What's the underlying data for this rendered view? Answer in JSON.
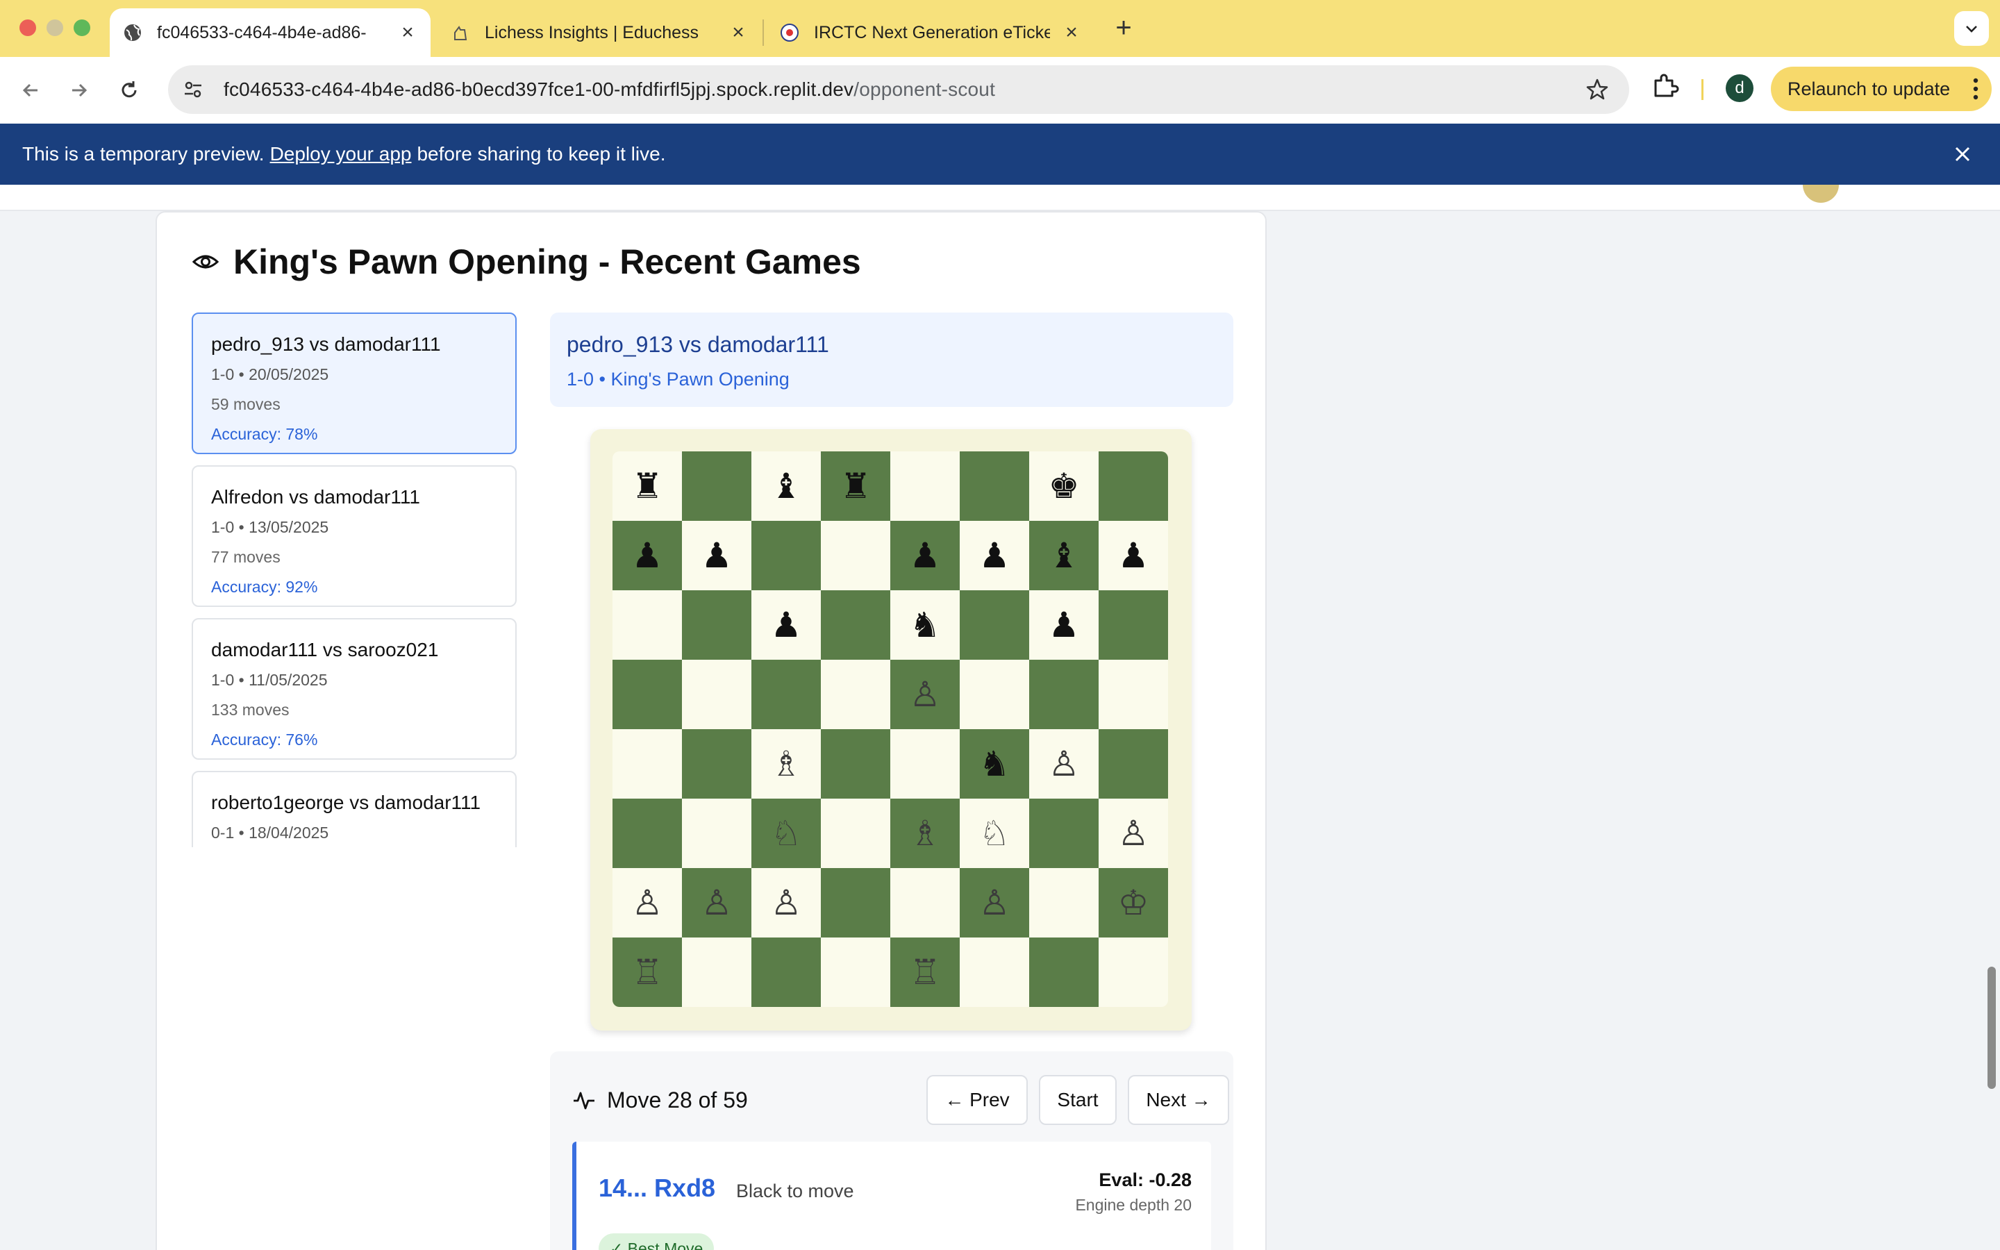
{
  "browser": {
    "tabs": [
      {
        "title": "fc046533-c464-4b4e-ad86-",
        "active": true,
        "favicon": "globe-icon"
      },
      {
        "title": "Lichess Insights | Educhess",
        "active": false,
        "favicon": "lichess-icon"
      },
      {
        "title": "IRCTC Next Generation eTicke",
        "active": false,
        "favicon": "irctc-icon"
      }
    ],
    "url_host": "fc046533-c464-4b4e-ad86-b0ecd397fce1-00-mfdfirfl5jpj.spock.replit.dev",
    "url_path": "/opponent-scout",
    "profile_initial": "d",
    "relaunch_label": "Relaunch to update"
  },
  "banner": {
    "text_before": "This is a temporary preview.",
    "link": "Deploy your app",
    "text_after": "before sharing to keep it live."
  },
  "section": {
    "title": "King's Pawn Opening - Recent Games"
  },
  "games": [
    {
      "title": "pedro_913 vs damodar111",
      "meta": "1-0 • 20/05/2025",
      "moves": "59 moves",
      "accuracy": "Accuracy: 78%",
      "selected": true
    },
    {
      "title": "Alfredon vs damodar111",
      "meta": "1-0 • 13/05/2025",
      "moves": "77 moves",
      "accuracy": "Accuracy: 92%",
      "selected": false
    },
    {
      "title": "damodar111 vs sarooz021",
      "meta": "1-0 • 11/05/2025",
      "moves": "133 moves",
      "accuracy": "Accuracy: 76%",
      "selected": false
    },
    {
      "title": "roberto1george vs damodar111",
      "meta": "0-1 • 18/04/2025",
      "moves": "",
      "accuracy": "",
      "selected": false
    }
  ],
  "selected_game": {
    "title": "pedro_913 vs damodar111",
    "subtitle": "1-0 • King's Pawn Opening"
  },
  "board": {
    "rows": [
      [
        "r",
        "",
        "b",
        "r",
        "",
        "",
        "k",
        ""
      ],
      [
        "p",
        "p",
        "",
        "",
        "p",
        "p",
        "b",
        "p"
      ],
      [
        "",
        "",
        "p",
        "",
        "n",
        "",
        "p",
        ""
      ],
      [
        "",
        "",
        "",
        "",
        "P",
        "",
        "",
        ""
      ],
      [
        "",
        "",
        "B",
        "",
        "",
        "n",
        "P",
        ""
      ],
      [
        "",
        "",
        "N",
        "",
        "B",
        "N",
        "",
        "P"
      ],
      [
        "P",
        "P",
        "P",
        "",
        "",
        "P",
        "",
        "K"
      ],
      [
        "R",
        "",
        "",
        "",
        "R",
        "",
        "",
        ""
      ]
    ],
    "light_color": "#fbfbec",
    "dark_color": "#5a7d48"
  },
  "move_panel": {
    "label": "Move 28 of 59",
    "prev_label": "← Prev",
    "start_label": "Start",
    "next_label": "Next →",
    "current_move": "14... Rxd8",
    "turn": "Black to move",
    "eval": "Eval: -0.28",
    "depth": "Engine depth 20",
    "badge": "✓ Best Move"
  },
  "colors": {
    "accent": "#2a62d8",
    "banner": "#1a3f7e",
    "tabstrip": "#f7e17c"
  }
}
